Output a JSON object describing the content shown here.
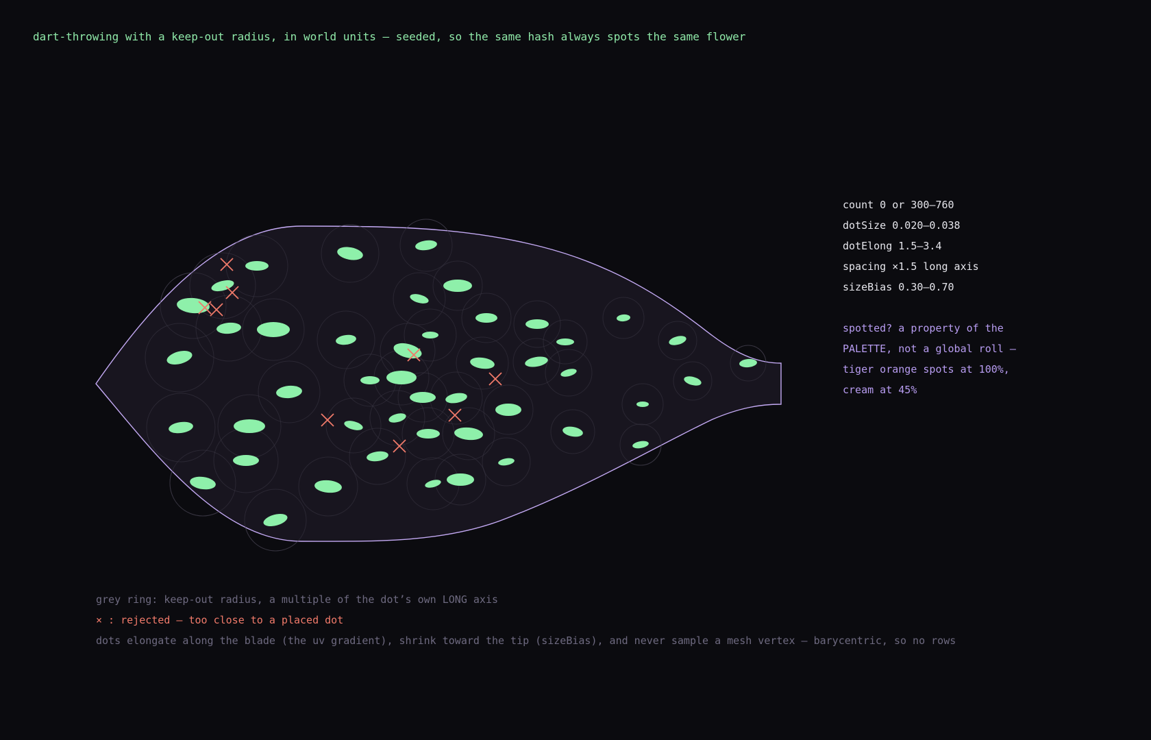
{
  "heading": "dart‑throwing with a keep‑out radius, in world units — seeded, so the same hash always spots the same flower",
  "params": [
    "count 0 or 300–760",
    "dotSize 0.020–0.038",
    "dotElong 1.5–3.4",
    "spacing ×1.5 long axis",
    "sizeBias 0.30–0.70"
  ],
  "note": [
    "spotted? a property of the",
    "PALETTE, not a global roll —",
    "tiger orange spots at 100%,",
    "cream at 45%"
  ],
  "legend": {
    "grey_ring": "grey ring: keep‑out radius, a multiple of the dot’s own LONG axis",
    "rejected": "× : rejected — too close to a placed dot",
    "dots": "dots elongate along the blade (the uv gradient), shrink toward the tip (sizeBias), and never sample a mesh vertex — barycentric, so no rows"
  },
  "colors": {
    "background": "#0b0b0f",
    "petal_fill": "#18151f",
    "petal_outline": "#c4aaf4",
    "dot": "#8ef0aa",
    "keepout_ring": "#3a3744",
    "rejected_mark": "#f07a6a",
    "heading": "#8fe8a8",
    "params_text": "#e6e6ec",
    "note_text": "#b79cf0"
  }
}
